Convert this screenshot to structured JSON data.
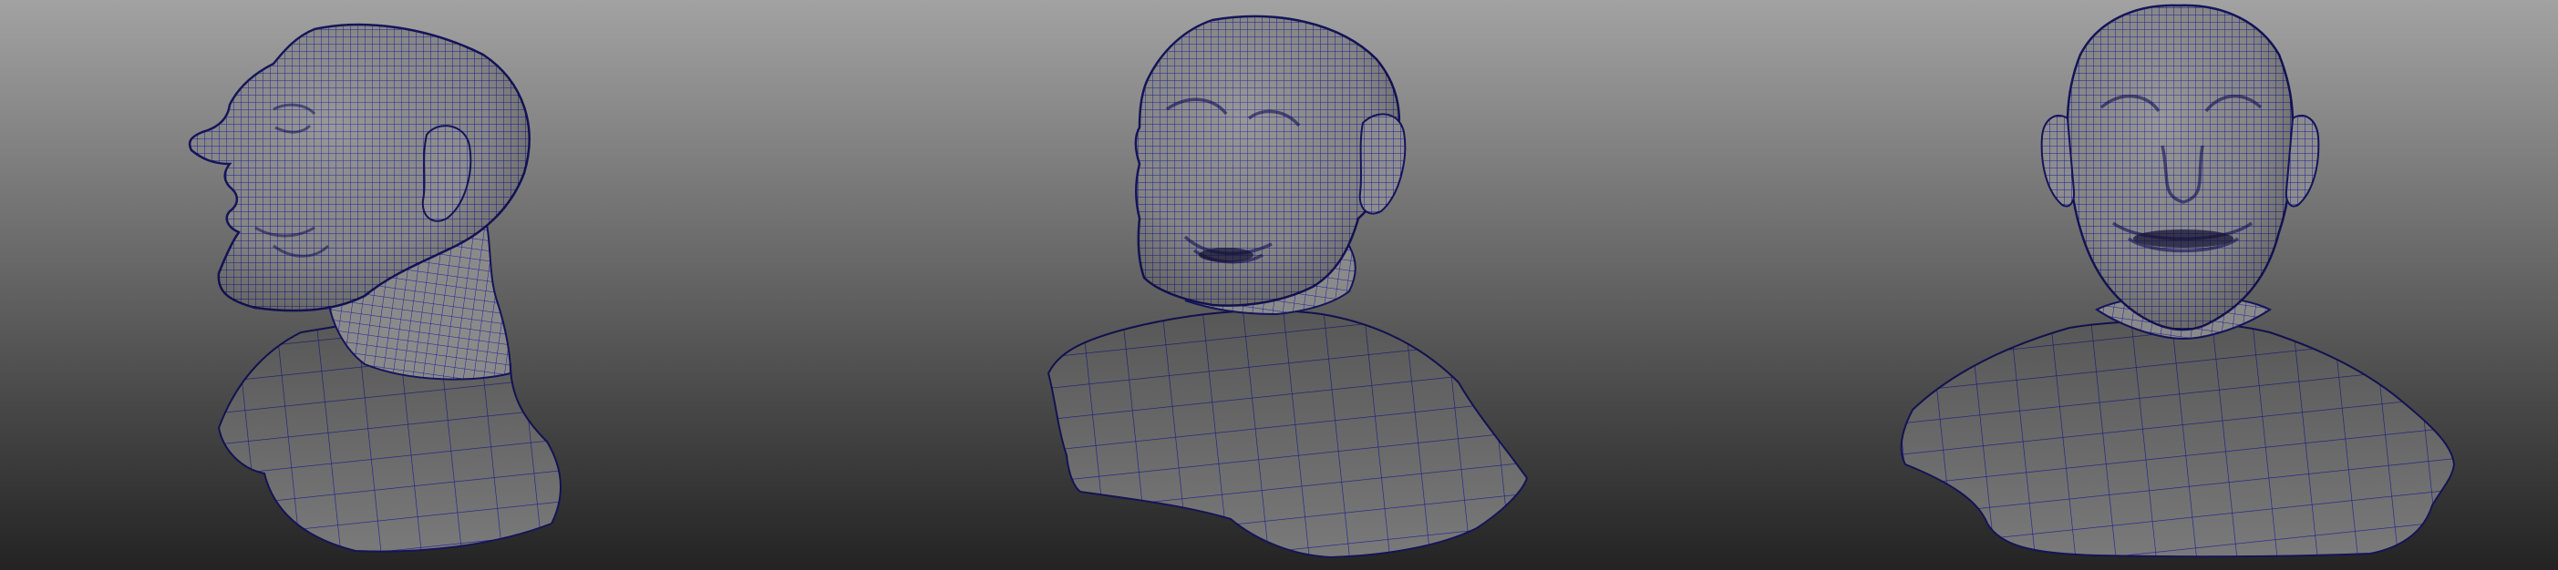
{
  "viewport": {
    "background_top": "#a2a2a2",
    "background_bottom": "#232323"
  },
  "mesh": {
    "surface_color": "#8d8d8d",
    "wireframe_color": "#1e1e9a",
    "outline_color": "#14145a"
  },
  "views": [
    {
      "id": "left-profile",
      "name": "bust-left-profile-view"
    },
    {
      "id": "three-quarter",
      "name": "bust-three-quarter-view"
    },
    {
      "id": "front",
      "name": "bust-front-view"
    }
  ]
}
